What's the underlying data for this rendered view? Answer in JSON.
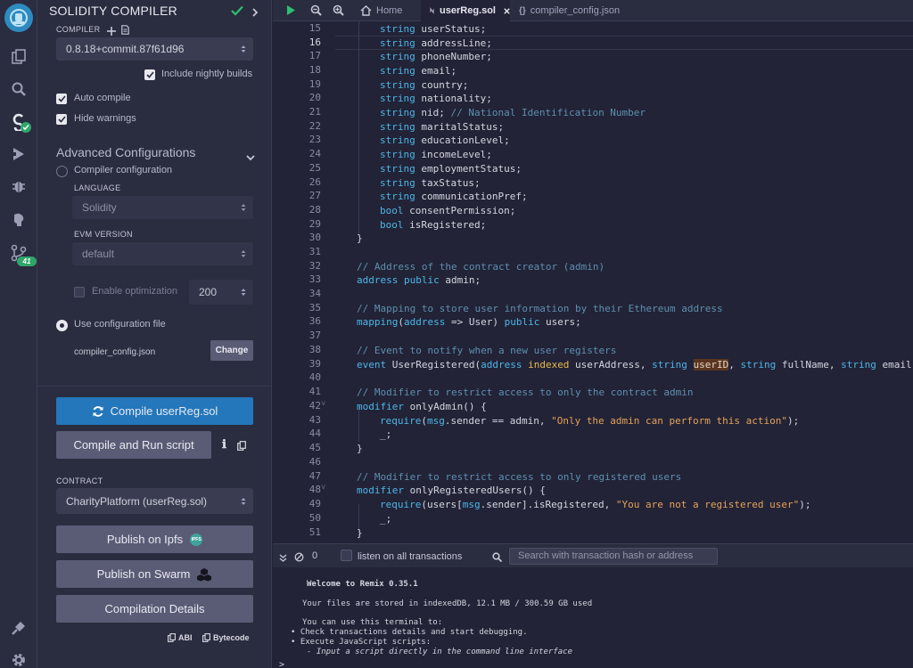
{
  "panel": {
    "title": "SOLIDITY COMPILER",
    "compiler_label": "COMPILER",
    "compiler_version": "0.8.18+commit.87f61d96",
    "include_nightly": "Include nightly builds",
    "auto_compile": "Auto compile",
    "hide_warnings": "Hide warnings",
    "advanced": "Advanced Configurations",
    "compiler_configuration": "Compiler configuration",
    "language_label": "LANGUAGE",
    "language_value": "Solidity",
    "evm_label": "EVM VERSION",
    "evm_value": "default",
    "enable_optimization": "Enable optimization",
    "runs": "200",
    "use_config_file": "Use configuration file",
    "config_file": "compiler_config.json",
    "change": "Change",
    "compile_btn": "Compile userReg.sol",
    "compile_run_btn": "Compile and Run script",
    "contract_label": "CONTRACT",
    "contract_value": "CharityPlatform (userReg.sol)",
    "publish_ipfs": "Publish on Ipfs",
    "ipfs_badge": "IPFS",
    "publish_swarm": "Publish on Swarm",
    "compilation_details": "Compilation Details",
    "abi": "ABI",
    "bytecode": "Bytecode"
  },
  "rail": {
    "badge_count": "41"
  },
  "tabs": {
    "home": "Home",
    "active_file": "userReg.sol",
    "config_file": "compiler_config.json"
  },
  "editor": {
    "line_numbers": [
      "15",
      "16",
      "17",
      "18",
      "19",
      "20",
      "21",
      "22",
      "23",
      "24",
      "25",
      "26",
      "27",
      "28",
      "29",
      "30",
      "31",
      "32",
      "33",
      "34",
      "35",
      "36",
      "37",
      "38",
      "39",
      "40",
      "41",
      "42",
      "43",
      "44",
      "45",
      "46",
      "47",
      "48",
      "49",
      "50",
      "51"
    ],
    "lines": {
      "l15": {
        "kw": "string",
        "rest": " userStatus;"
      },
      "l16": {
        "kw": "string",
        "rest": " addressLine;"
      },
      "l17": {
        "kw": "string",
        "rest": " phoneNumber;"
      },
      "l18": {
        "kw": "string",
        "rest": " email;"
      },
      "l19": {
        "kw": "string",
        "rest": " country;"
      },
      "l20": {
        "kw": "string",
        "rest": " nationality;"
      },
      "l21": {
        "kw": "string",
        "rest": " nid; ",
        "comment": "// National Identification Number"
      },
      "l22": {
        "kw": "string",
        "rest": " maritalStatus;"
      },
      "l23": {
        "kw": "string",
        "rest": " educationLevel;"
      },
      "l24": {
        "kw": "string",
        "rest": " incomeLevel;"
      },
      "l25": {
        "kw": "string",
        "rest": " employmentStatus;"
      },
      "l26": {
        "kw": "string",
        "rest": " taxStatus;"
      },
      "l27": {
        "kw": "string",
        "rest": " communicationPref;"
      },
      "l28": {
        "kw": "bool",
        "rest": " consentPermission;"
      },
      "l29": {
        "kw": "bool",
        "rest": " isRegistered;"
      },
      "l30": {
        "rest": "}"
      },
      "l32": {
        "comment": "// Address of the contract creator (admin)"
      },
      "l33": {
        "kw": "address",
        "kw2": " public",
        "rest": " admin;"
      },
      "l35": {
        "comment": "// Mapping to store user information by their Ethereum address"
      },
      "l36": {
        "kw": "mapping",
        "p1": "(",
        "kw2": "address",
        "p2": " => User) ",
        "kw3": "public",
        "rest": " users;"
      },
      "l38": {
        "comment": "// Event to notify when a new user registers"
      },
      "l39": {
        "kw": "event",
        "p1": " UserRegistered(",
        "kw2": "address",
        "ind": " indexed",
        "p2": " userAddress, ",
        "kw3": "string",
        "hl": "userID",
        "p3": ", ",
        "kw4": "string",
        "p4": " fullName, ",
        "kw5": "string",
        "rest": " email);"
      },
      "l41": {
        "comment": "// Modifier to restrict access to only the contract admin"
      },
      "l42": {
        "kw": "modifier",
        "rest": " onlyAdmin() {"
      },
      "l43": {
        "kw": "require",
        "p1": "(",
        "kw2": "msg",
        "p2": ".sender == admin, ",
        "str": "\"Only the admin can perform this action\"",
        "rest": ");"
      },
      "l44": {
        "rest": "_;"
      },
      "l45": {
        "rest": "}"
      },
      "l47": {
        "comment": "// Modifier to restrict access to only registered users"
      },
      "l48": {
        "kw": "modifier",
        "rest": " onlyRegisteredUsers() {"
      },
      "l49": {
        "kw": "require",
        "p1": "(users[",
        "kw2": "msg",
        "p2": ".sender].isRegistered, ",
        "str": "\"You are not a registered user\"",
        "rest": ");"
      },
      "l50": {
        "rest": "_;"
      },
      "l51": {
        "rest": "}"
      }
    }
  },
  "terminal": {
    "count": "0",
    "listen": "listen on all transactions",
    "search_placeholder": "Search with transaction hash or address",
    "welcome": "Welcome to Remix 0.35.1",
    "storage": "Your files are stored in indexedDB, 12.1 MB / 300.59 GB used",
    "use_terminal": "You can use this terminal to:",
    "bullet1": "Check transactions details and start debugging.",
    "bullet2": "Execute JavaScript scripts:",
    "sub1": "- Input a script directly in the command line interface",
    "prompt": ">"
  }
}
